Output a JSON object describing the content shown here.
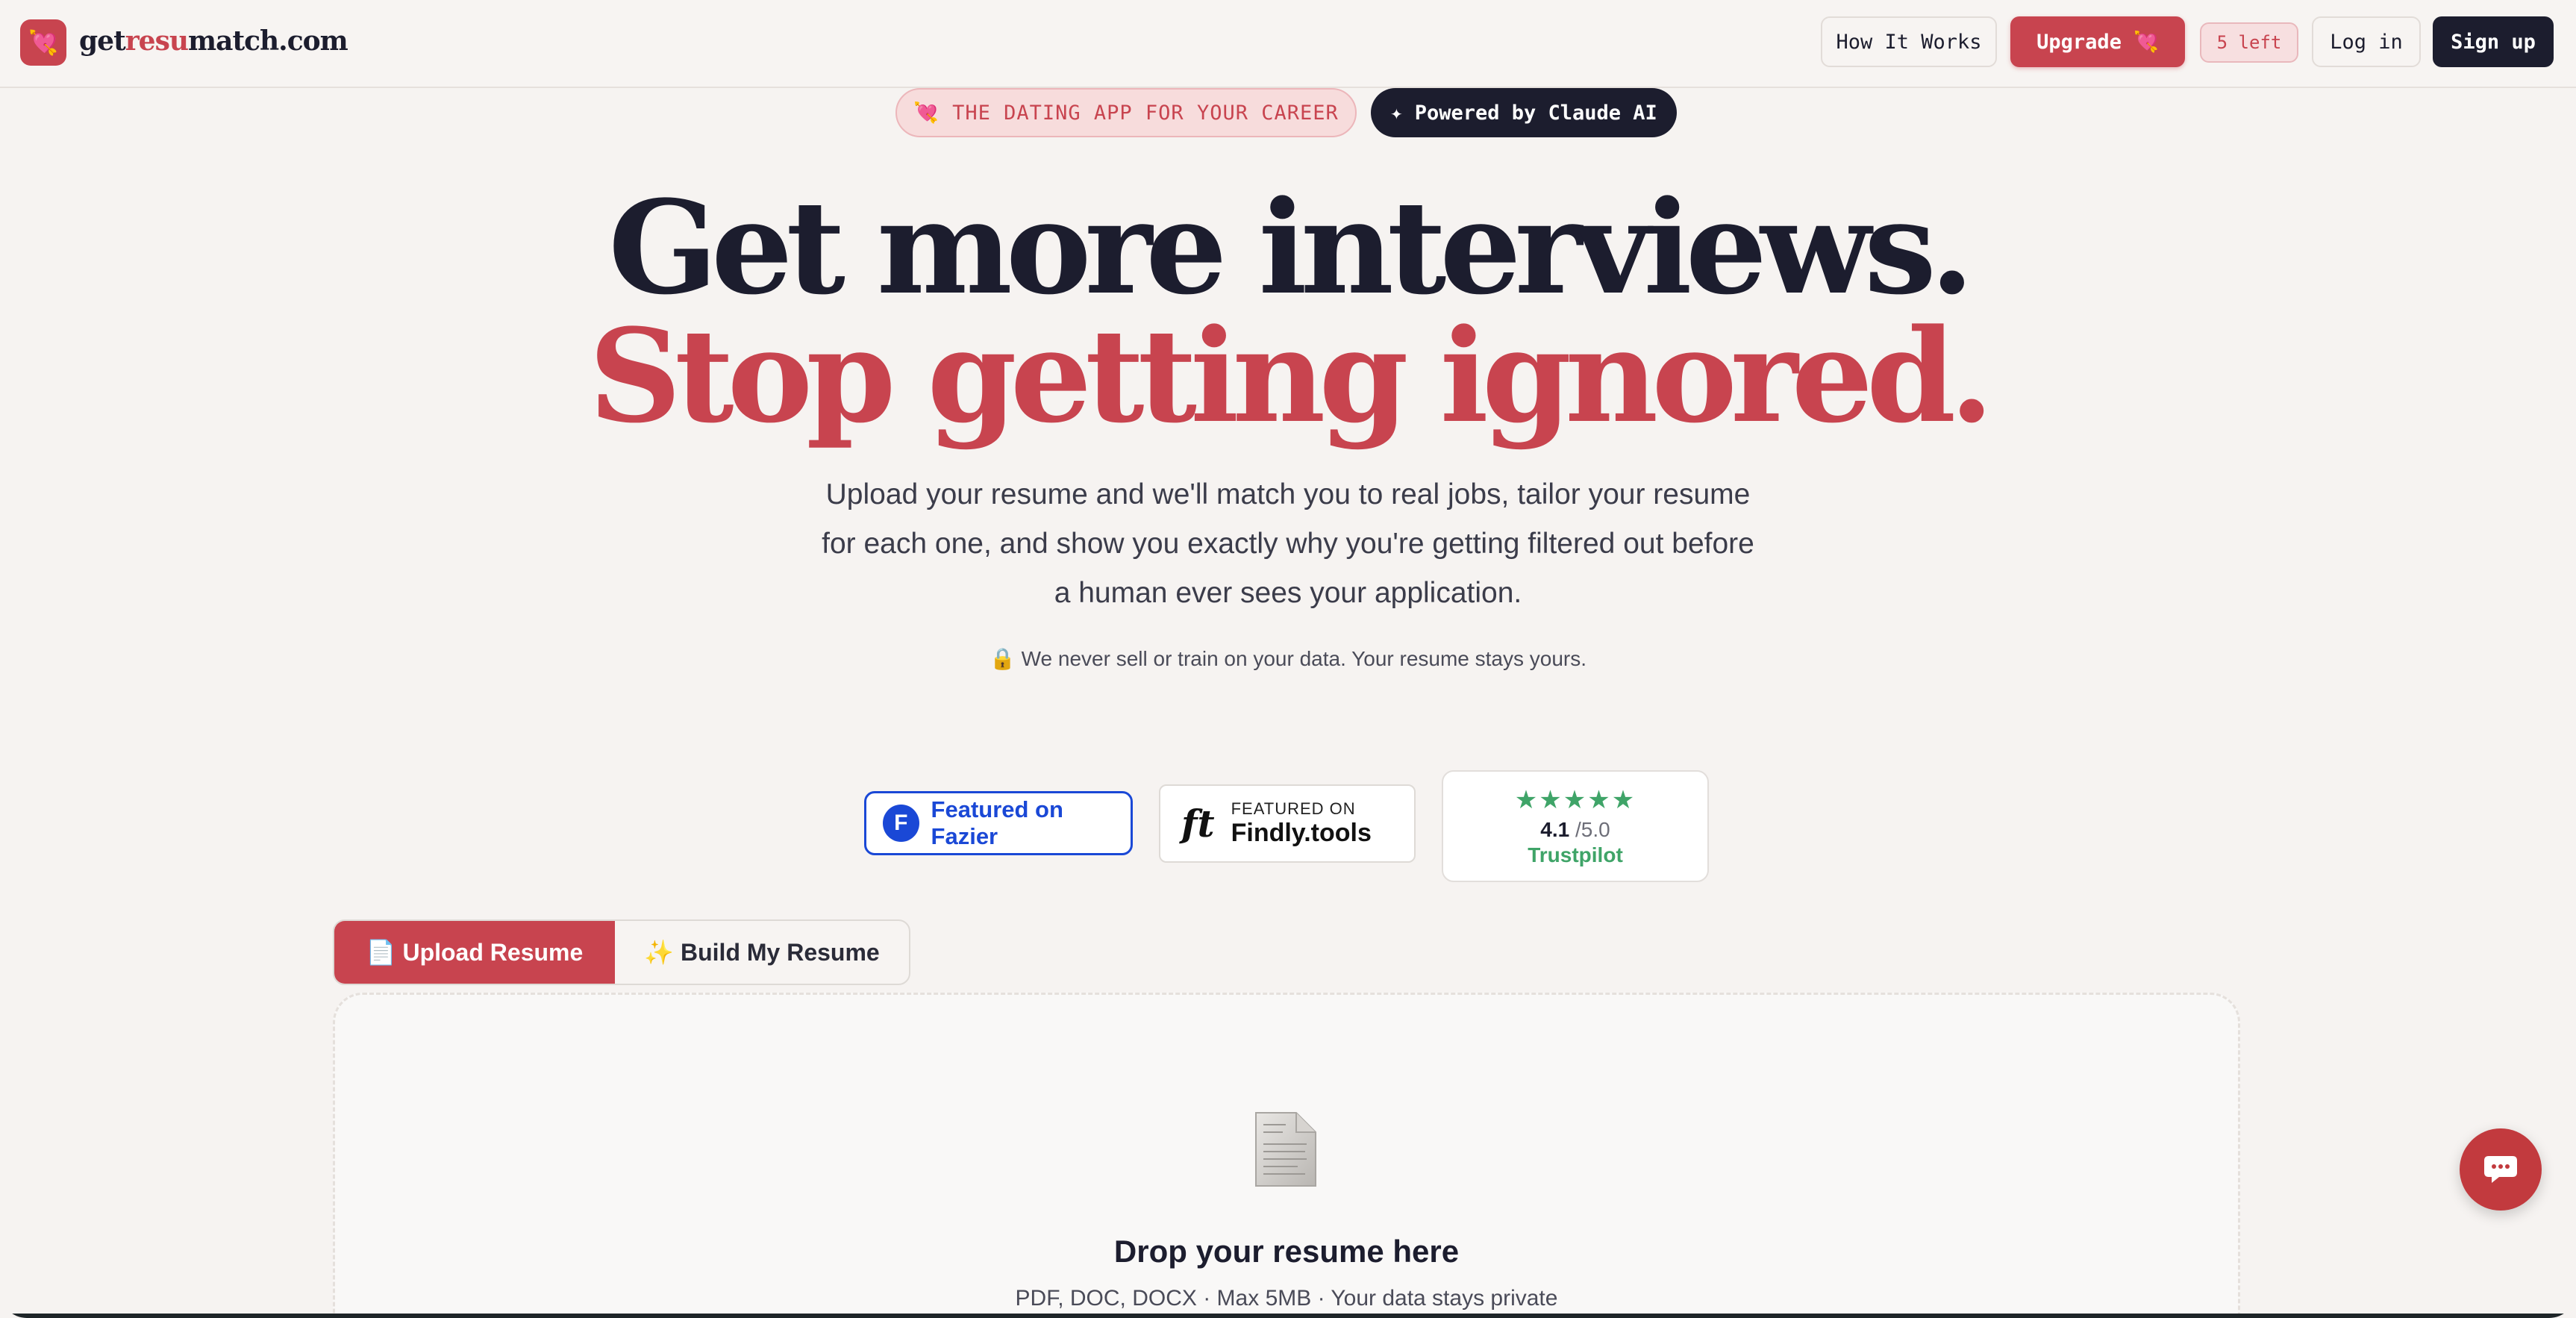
{
  "header": {
    "logo_icon": "💘",
    "logo_parts": [
      "get",
      "resu",
      "match.com"
    ],
    "how_it_works": "How It Works",
    "upgrade": "Upgrade 💘",
    "remaining": "5 left",
    "login": "Log in",
    "signup": "Sign up"
  },
  "pills": {
    "tagline": "💘 THE DATING APP FOR YOUR CAREER",
    "powered": "✦ Powered by Claude AI"
  },
  "hero": {
    "line1": "Get more interviews.",
    "line2": "Stop getting ignored.",
    "subtitle": "Upload your resume and we'll match you to real jobs, tailor your resume for each one, and show you exactly why you're getting filtered out before a human ever sees your application.",
    "privacy": "🔒 We never sell or train on your data. Your resume stays yours."
  },
  "badges": {
    "fazier": "Featured on Fazier",
    "fazier_mark": "F",
    "findly_mark": "ft",
    "findly_small": "FEATURED ON",
    "findly_name": "Findly.tools",
    "trust_stars": "★★★★★",
    "trust_score": "4.1",
    "trust_scale": "/5.0",
    "trust_name": "Trustpilot"
  },
  "tabs": {
    "upload": "📄 Upload Resume",
    "build": "✨ Build My Resume"
  },
  "dropzone": {
    "title": "Drop your resume here",
    "subtitle": "PDF, DOC, DOCX · Max 5MB · Your data stays private"
  },
  "colors": {
    "accent": "#c8444f",
    "dark": "#1c1d2e",
    "background": "#f6f3f1",
    "fazier_blue": "#1a48d6",
    "trustpilot_green": "#3fa468"
  },
  "icons": {
    "logo": "heart-arrow-icon",
    "document": "document-icon",
    "chat": "chat-bubble-icon"
  }
}
